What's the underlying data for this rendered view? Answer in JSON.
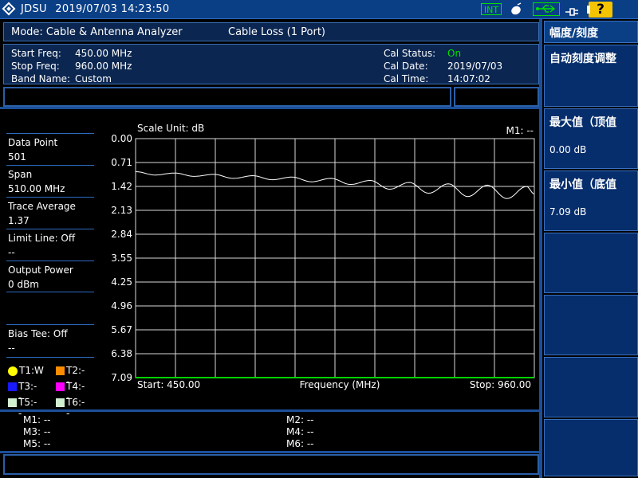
{
  "status_bar": {
    "brand": "JDSU",
    "datetime": "2019/07/03 14:23:50",
    "int_label": "INT",
    "icons": [
      "signal-icon",
      "usb-icon",
      "power-plug-icon",
      "battery-icon",
      "help-icon"
    ],
    "help_label": "?"
  },
  "mode_bar": {
    "mode": "Mode: Cable & Antenna Analyzer",
    "measurement": "Cable Loss (1 Port)"
  },
  "info": {
    "start_label": "Start Freq:",
    "start_value": "450.00 MHz",
    "stop_label": "Stop Freq:",
    "stop_value": "960.00 MHz",
    "band_label": "Band Name:",
    "band_value": "Custom",
    "cal_status_label": "Cal Status:",
    "cal_status_value": "On",
    "cal_date_label": "Cal Date:",
    "cal_date_value": "2019/07/03",
    "cal_time_label": "Cal Time:",
    "cal_time_value": "14:07:02"
  },
  "left_panel": {
    "items": [
      {
        "label": "Data Point",
        "value": "501"
      },
      {
        "label": "Span",
        "value": "510.00 MHz"
      },
      {
        "label": "Trace Average",
        "value": "1.37"
      },
      {
        "label": "Limit Line: Off",
        "value": "--"
      },
      {
        "label": "Output Power",
        "value": "0 dBm"
      }
    ],
    "bias_label": "Bias Tee: Off",
    "bias_value": "--",
    "traces": [
      {
        "label": "T1:W",
        "color": "#ffff00",
        "shape": "circle"
      },
      {
        "label": "T2:--",
        "color": "#ff8c00",
        "shape": "square"
      },
      {
        "label": "T3:--",
        "color": "#1a1aff",
        "shape": "square"
      },
      {
        "label": "T4:--",
        "color": "#ff00ff",
        "shape": "square"
      },
      {
        "label": "T5:--",
        "color": "#d0f0d0",
        "shape": "square"
      },
      {
        "label": "T6:--",
        "color": "#d0f0d0",
        "shape": "square"
      }
    ]
  },
  "chart_data": {
    "type": "line",
    "scale_unit": "Scale Unit: dB",
    "marker_readout": "M1: --",
    "xlabel": "Frequency (MHz)",
    "x_start_label": "Start: 450.00",
    "x_stop_label": "Stop: 960.00",
    "xlim": [
      450,
      960
    ],
    "ylim": [
      0.0,
      7.09
    ],
    "y_inverted": true,
    "ytick_labels": [
      "0.00",
      "0.71",
      "1.42",
      "2.13",
      "2.84",
      "3.55",
      "4.25",
      "4.96",
      "5.67",
      "6.38",
      "7.09"
    ],
    "grid": true,
    "series": [
      {
        "color": "#ffffff",
        "x": [
          450,
          475,
          500,
          525,
          550,
          575,
          600,
          625,
          650,
          675,
          700,
          725,
          750,
          775,
          800,
          825,
          850,
          875,
          900,
          925,
          950,
          960
        ],
        "y": [
          0.98,
          1.08,
          1.02,
          1.12,
          1.06,
          1.18,
          1.1,
          1.22,
          1.14,
          1.28,
          1.18,
          1.36,
          1.24,
          1.5,
          1.3,
          1.62,
          1.34,
          1.72,
          1.38,
          1.78,
          1.42,
          1.64
        ]
      }
    ]
  },
  "markers": [
    {
      "label": "M1: --"
    },
    {
      "label": "M2: --"
    },
    {
      "label": "M3: --"
    },
    {
      "label": "M4: --"
    },
    {
      "label": "M5: --"
    },
    {
      "label": "M6: --"
    }
  ],
  "softkeys": {
    "k1": "幅度/刻度",
    "k2": "自动刻度调整",
    "k3_title": "最大值（顶值",
    "k3_value": "0.00 dB",
    "k4_title": "最小值（底值",
    "k4_value": "7.09 dB"
  }
}
